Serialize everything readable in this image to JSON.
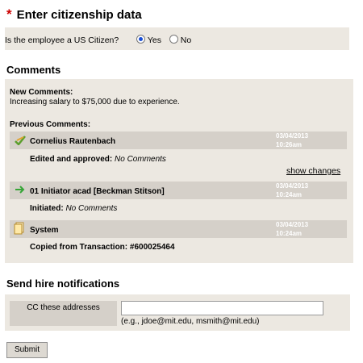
{
  "citizenship": {
    "title": "Enter citizenship data",
    "required_mark": "*",
    "question": "Is the employee a US Citizen?",
    "options": [
      {
        "label": "Yes",
        "selected": true
      },
      {
        "label": "No",
        "selected": false
      }
    ]
  },
  "comments": {
    "heading": "Comments",
    "new_label": "New Comments:",
    "new_text": "Increasing salary to $75,000 due to experience.",
    "previous_label": "Previous Comments:",
    "history": [
      {
        "icon": "approved-check-icon",
        "name": "Cornelius Rautenbach",
        "date": "03/04/2013",
        "time": "10:26am",
        "action": "Edited and approved:",
        "comment": "No Comments",
        "link": "show changes"
      },
      {
        "icon": "green-arrow-icon",
        "name": "01 Initiator acad [Beckman Stitson]",
        "date": "03/04/2013",
        "time": "10:24am",
        "action": "Initiated:",
        "comment": "No Comments"
      },
      {
        "icon": "document-copy-icon",
        "name": "System",
        "date": "03/04/2013",
        "time": "10:24am",
        "action": "Copied from Transaction:",
        "comment": "#600025464"
      }
    ]
  },
  "notifications": {
    "heading": "Send hire notifications",
    "cc_label": "CC these addresses",
    "cc_value": "",
    "cc_hint": "(e.g., jdoe@mit.edu, msmith@mit.edu)"
  },
  "submit_label": "Submit",
  "colors": {
    "required": "#cc0000",
    "panel": "#ece8e1",
    "row_header": "#d5d0c9",
    "radio_selected": "#1a4fd6"
  }
}
